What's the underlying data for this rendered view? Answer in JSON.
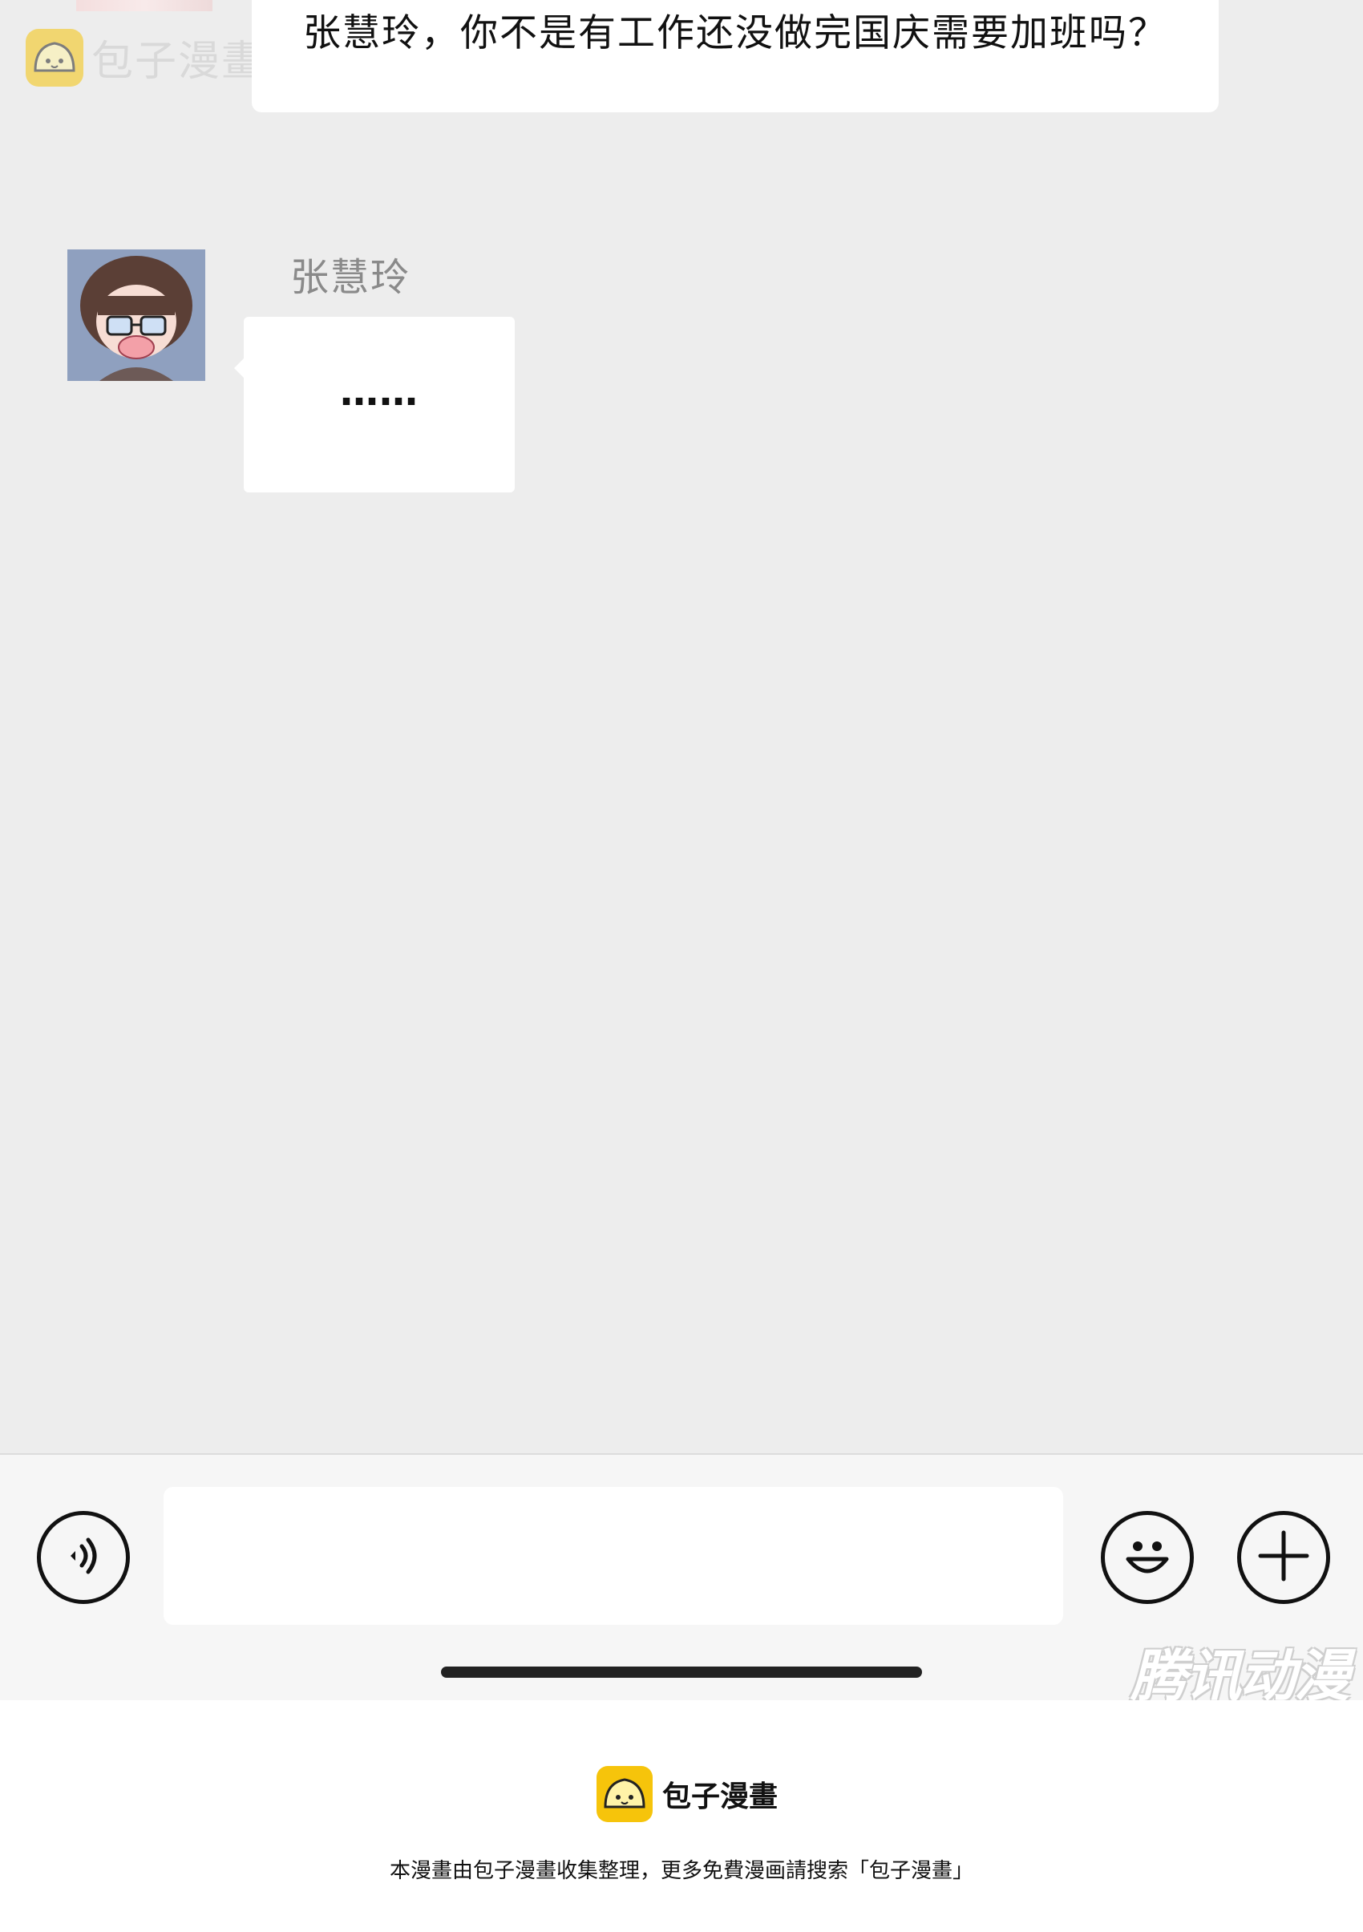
{
  "chat": {
    "top_message": "张慧玲，你不是有工作还没做完国庆需要加班吗？",
    "sender_name": "张慧玲",
    "message": "……"
  },
  "watermark": {
    "brand": "包子漫畫",
    "tencent": "腾讯动漫"
  },
  "input_bar": {
    "voice_icon": "voice-icon",
    "emoji_icon": "smiley-icon",
    "plus_icon": "plus-icon",
    "input_value": ""
  },
  "footer": {
    "brand_name": "包子漫畫",
    "note": "本漫畫由包子漫畫收集整理，更多免費漫画請搜索「包子漫畫」"
  },
  "colors": {
    "chat_bg": "#ededed",
    "bubble": "#ffffff",
    "brand_yellow": "#f6c40b"
  }
}
